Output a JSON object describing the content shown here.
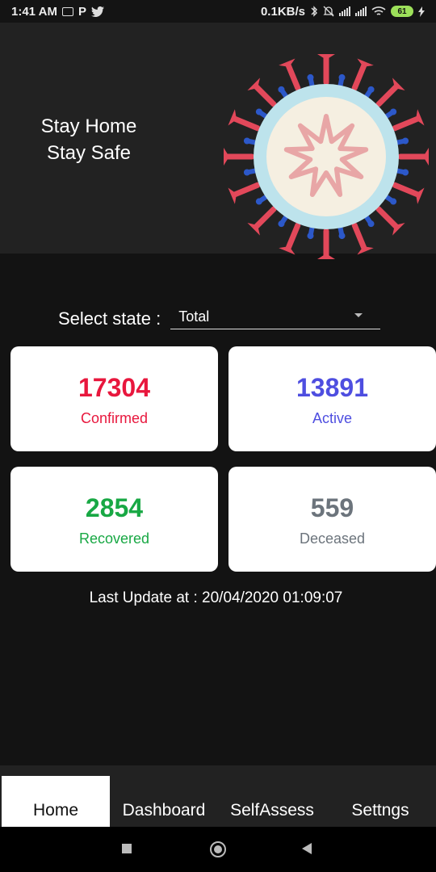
{
  "status_bar": {
    "time": "1:41 AM",
    "speed": "0.1KB/s",
    "battery": "61"
  },
  "header": {
    "line1": "Stay Home",
    "line2": "Stay Safe"
  },
  "state_selector": {
    "label": "Select state :",
    "value": "Total"
  },
  "stats": {
    "confirmed": {
      "value": "17304",
      "label": "Confirmed",
      "color": "#e8173d"
    },
    "active": {
      "value": "13891",
      "label": "Active",
      "color": "#4e4ee0"
    },
    "recovered": {
      "value": "2854",
      "label": "Recovered",
      "color": "#18a844"
    },
    "deceased": {
      "value": "559",
      "label": "Deceased",
      "color": "#6c747c"
    }
  },
  "last_update": "Last Update at : 20/04/2020 01:09:07",
  "bottom_nav": {
    "tabs": [
      {
        "label": "Home",
        "active": true
      },
      {
        "label": "Dashboard",
        "active": false
      },
      {
        "label": "SelfAssess",
        "active": false
      },
      {
        "label": "Settngs",
        "active": false
      }
    ]
  },
  "icons": {
    "status_left": [
      "photo-icon",
      "p-icon",
      "twitter-icon"
    ],
    "status_right": [
      "bluetooth-icon",
      "mute-icon",
      "signal-icon",
      "wifi-icon",
      "battery-icon",
      "charging-icon"
    ],
    "system_nav": [
      "recents-icon",
      "home-icon",
      "back-icon"
    ],
    "header_art": "coronavirus-illustration"
  }
}
